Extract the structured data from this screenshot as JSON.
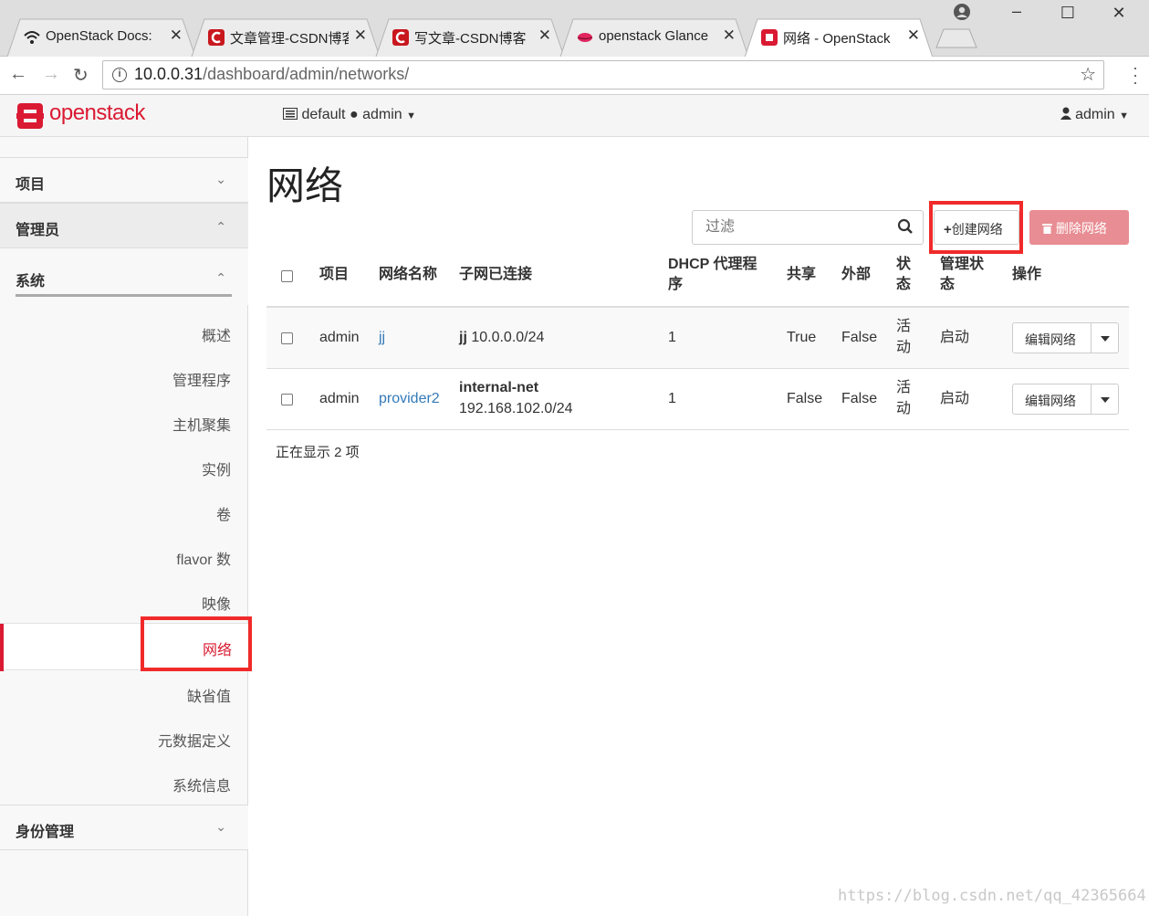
{
  "browser": {
    "tabs": [
      {
        "label": "OpenStack Docs: ",
        "icon": "wifi-icon"
      },
      {
        "label": "文章管理-CSDN博客",
        "icon": "csdn-icon"
      },
      {
        "label": "写文章-CSDN博客",
        "icon": "csdn-icon"
      },
      {
        "label": "openstack Glance",
        "icon": "lips-icon"
      },
      {
        "label": "网络 - OpenStack",
        "icon": "openstack-icon"
      }
    ],
    "url_host": "10.0.0.31",
    "url_path": "/dashboard/admin/networks/",
    "info_glyph": "i",
    "close_glyph": "✕"
  },
  "header": {
    "logo_text": "openstack",
    "project": "default",
    "region": "admin",
    "user": "admin"
  },
  "sidebar": {
    "sections": [
      {
        "label": "项目",
        "expanded": false
      },
      {
        "label": "管理员",
        "expanded": true
      },
      {
        "label": "系统",
        "expanded": true
      },
      {
        "label": "身份管理",
        "expanded": false
      }
    ],
    "items": [
      "概述",
      "管理程序",
      "主机聚集",
      "实例",
      "卷",
      "flavor 数",
      "映像",
      "网络",
      "缺省值",
      "元数据定义",
      "系统信息"
    ],
    "active_item": "网络"
  },
  "main": {
    "title": "网络",
    "filter_placeholder": "过滤",
    "create_label": "创建网络",
    "delete_label": "删除网络",
    "columns": [
      "项目",
      "网络名称",
      "子网已连接",
      "DHCP 代理程\n序",
      "共享",
      "外部",
      "状\n态",
      "管理状\n态",
      "操作"
    ],
    "rows": [
      {
        "project": "admin",
        "name": "jj",
        "subnet_name": "jj",
        "subnet_cidr": "10.0.0.0/24",
        "dhcp": "1",
        "shared": "True",
        "external": "False",
        "status_1": "活",
        "status_2": "动",
        "admin_state": "启动",
        "action": "编辑网络"
      },
      {
        "project": "admin",
        "name": "provider2",
        "subnet_name": "internal-net",
        "subnet_cidr": "192.168.102.0/24",
        "dhcp": "1",
        "shared": "False",
        "external": "False",
        "status_1": "活",
        "status_2": "动",
        "admin_state": "启动",
        "action": "编辑网络"
      }
    ],
    "count_text": "正在显示 2 项"
  },
  "watermark": "https://blog.csdn.net/qq_42365664",
  "colors": {
    "accent": "#da1a32",
    "highlight": "#f02a2a",
    "link": "#337ab7",
    "danger_disabled": "#e88d93"
  }
}
